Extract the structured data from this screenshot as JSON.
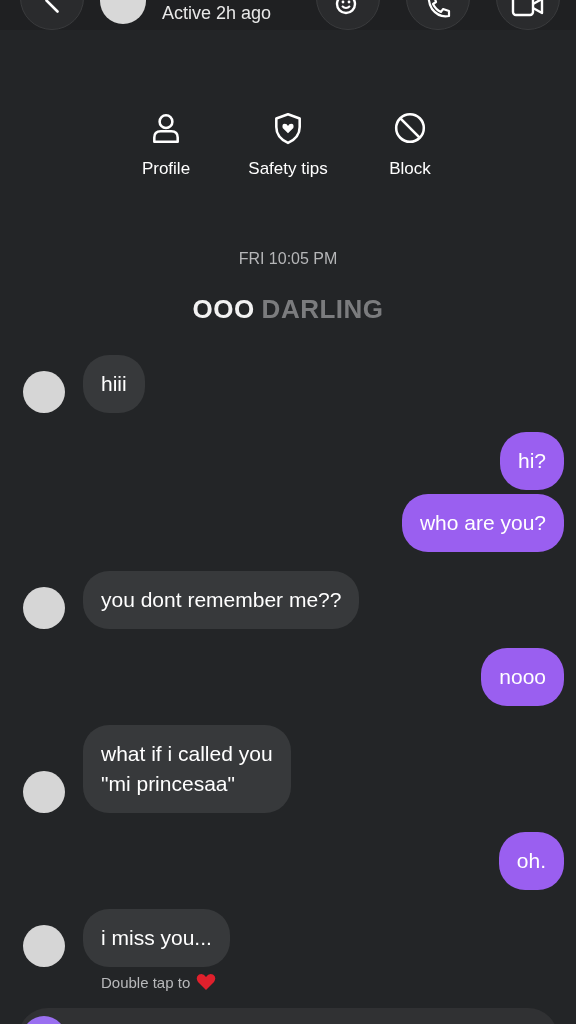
{
  "header": {
    "status": "Active 2h ago"
  },
  "actions": [
    {
      "kind": "profile",
      "label": "Profile"
    },
    {
      "kind": "safety",
      "label": "Safety tips"
    },
    {
      "kind": "block",
      "label": "Block"
    }
  ],
  "timestamp": "FRI 10:05 PM",
  "title": {
    "first": "OOO",
    "second": "DARLING"
  },
  "messages": [
    {
      "kind": "received",
      "text": "hiii"
    },
    {
      "kind": "sent",
      "text": "hi?"
    },
    {
      "kind": "sent",
      "text": "who are you?"
    },
    {
      "kind": "received",
      "text": "you dont remember me??"
    },
    {
      "kind": "sent",
      "text": "nooo"
    },
    {
      "kind": "received",
      "text": "what if i called you\n\"mi princesaa\""
    },
    {
      "kind": "sent",
      "text": "oh."
    },
    {
      "kind": "received",
      "text": "i miss you..."
    }
  ],
  "hint": "Double tap to"
}
